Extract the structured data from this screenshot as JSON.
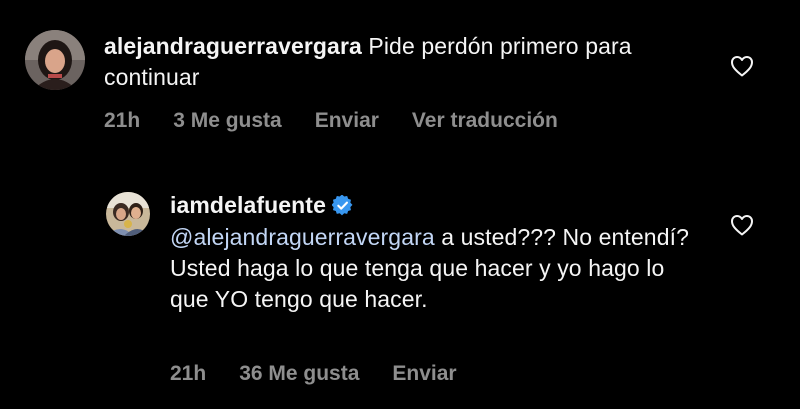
{
  "comments": [
    {
      "username": "alejandraguerravergara",
      "text": "Pide perdón primero para continuar",
      "time": "21h",
      "likes": "3 Me gusta",
      "reply": "Enviar",
      "translate": "Ver traducción",
      "verified": false
    },
    {
      "username": "iamdelafuente",
      "mention": "@alejandraguerravergara",
      "text": " a usted??? No entendí? Usted haga lo que tenga que hacer y yo hago lo que YO tengo que hacer.",
      "time": "21h",
      "likes": "36 Me gusta",
      "reply": "Enviar",
      "verified": true
    }
  ],
  "colors": {
    "background": "#000000",
    "text": "#f5f5f5",
    "meta": "#8e8e8e",
    "mention": "#c2d6f5",
    "verified": "#3897f0"
  },
  "icons": {
    "like": "heart-icon",
    "verified": "verified-badge-icon"
  }
}
